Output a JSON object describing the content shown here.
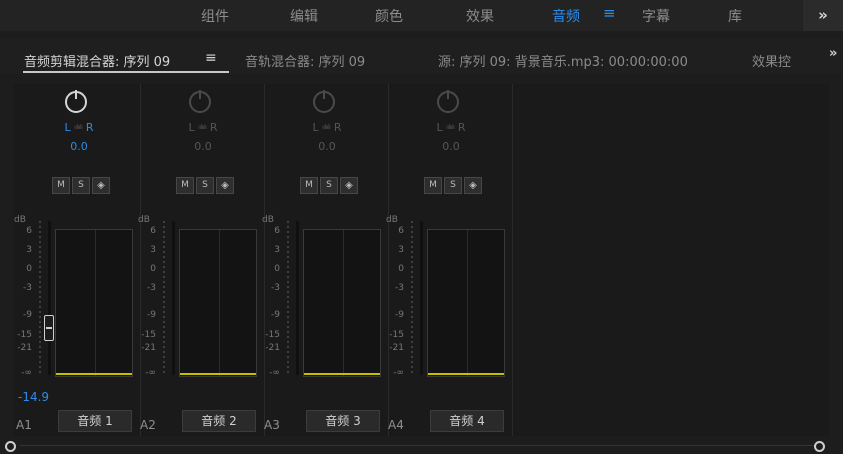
{
  "workspaces": {
    "items": [
      "组件",
      "编辑",
      "颜色",
      "效果",
      "音频",
      "字幕",
      "库"
    ],
    "active_index": 4,
    "active_menu_icon": "hamburger-menu-icon",
    "overflow_icon": "double-chevron-right-icon"
  },
  "tabs": {
    "items": [
      "音频剪辑混合器: 序列 09",
      "音轨混合器: 序列 09",
      "源: 序列 09: 背景音乐.mp3: 00:00:00:00",
      "效果控"
    ],
    "active_index": 0,
    "menu_icon": "hamburger-menu-icon",
    "overflow_icon": "double-chevron-right-icon"
  },
  "mixer": {
    "pan_left": "L",
    "pan_right": "R",
    "pan_mini": "ıılıılı",
    "db_label": "dB",
    "scale_ticks": [
      "6",
      "3",
      "0",
      "-3",
      "-9",
      "-15",
      "-21",
      "-∞"
    ],
    "buttons": {
      "mute": "M",
      "solo": "S"
    },
    "channels": [
      {
        "id": "A1",
        "name": "音频 1",
        "pan": "0.0",
        "volume": "-14.9",
        "active": true
      },
      {
        "id": "A2",
        "name": "音频 2",
        "pan": "0.0",
        "active": false
      },
      {
        "id": "A3",
        "name": "音频 3",
        "pan": "0.0",
        "active": false
      },
      {
        "id": "A4",
        "name": "音频 4",
        "pan": "0.0",
        "active": false
      }
    ]
  },
  "colors": {
    "accent": "#2d8ceb",
    "meter_floor": "#c7c000",
    "background": "#1d1d1d"
  }
}
